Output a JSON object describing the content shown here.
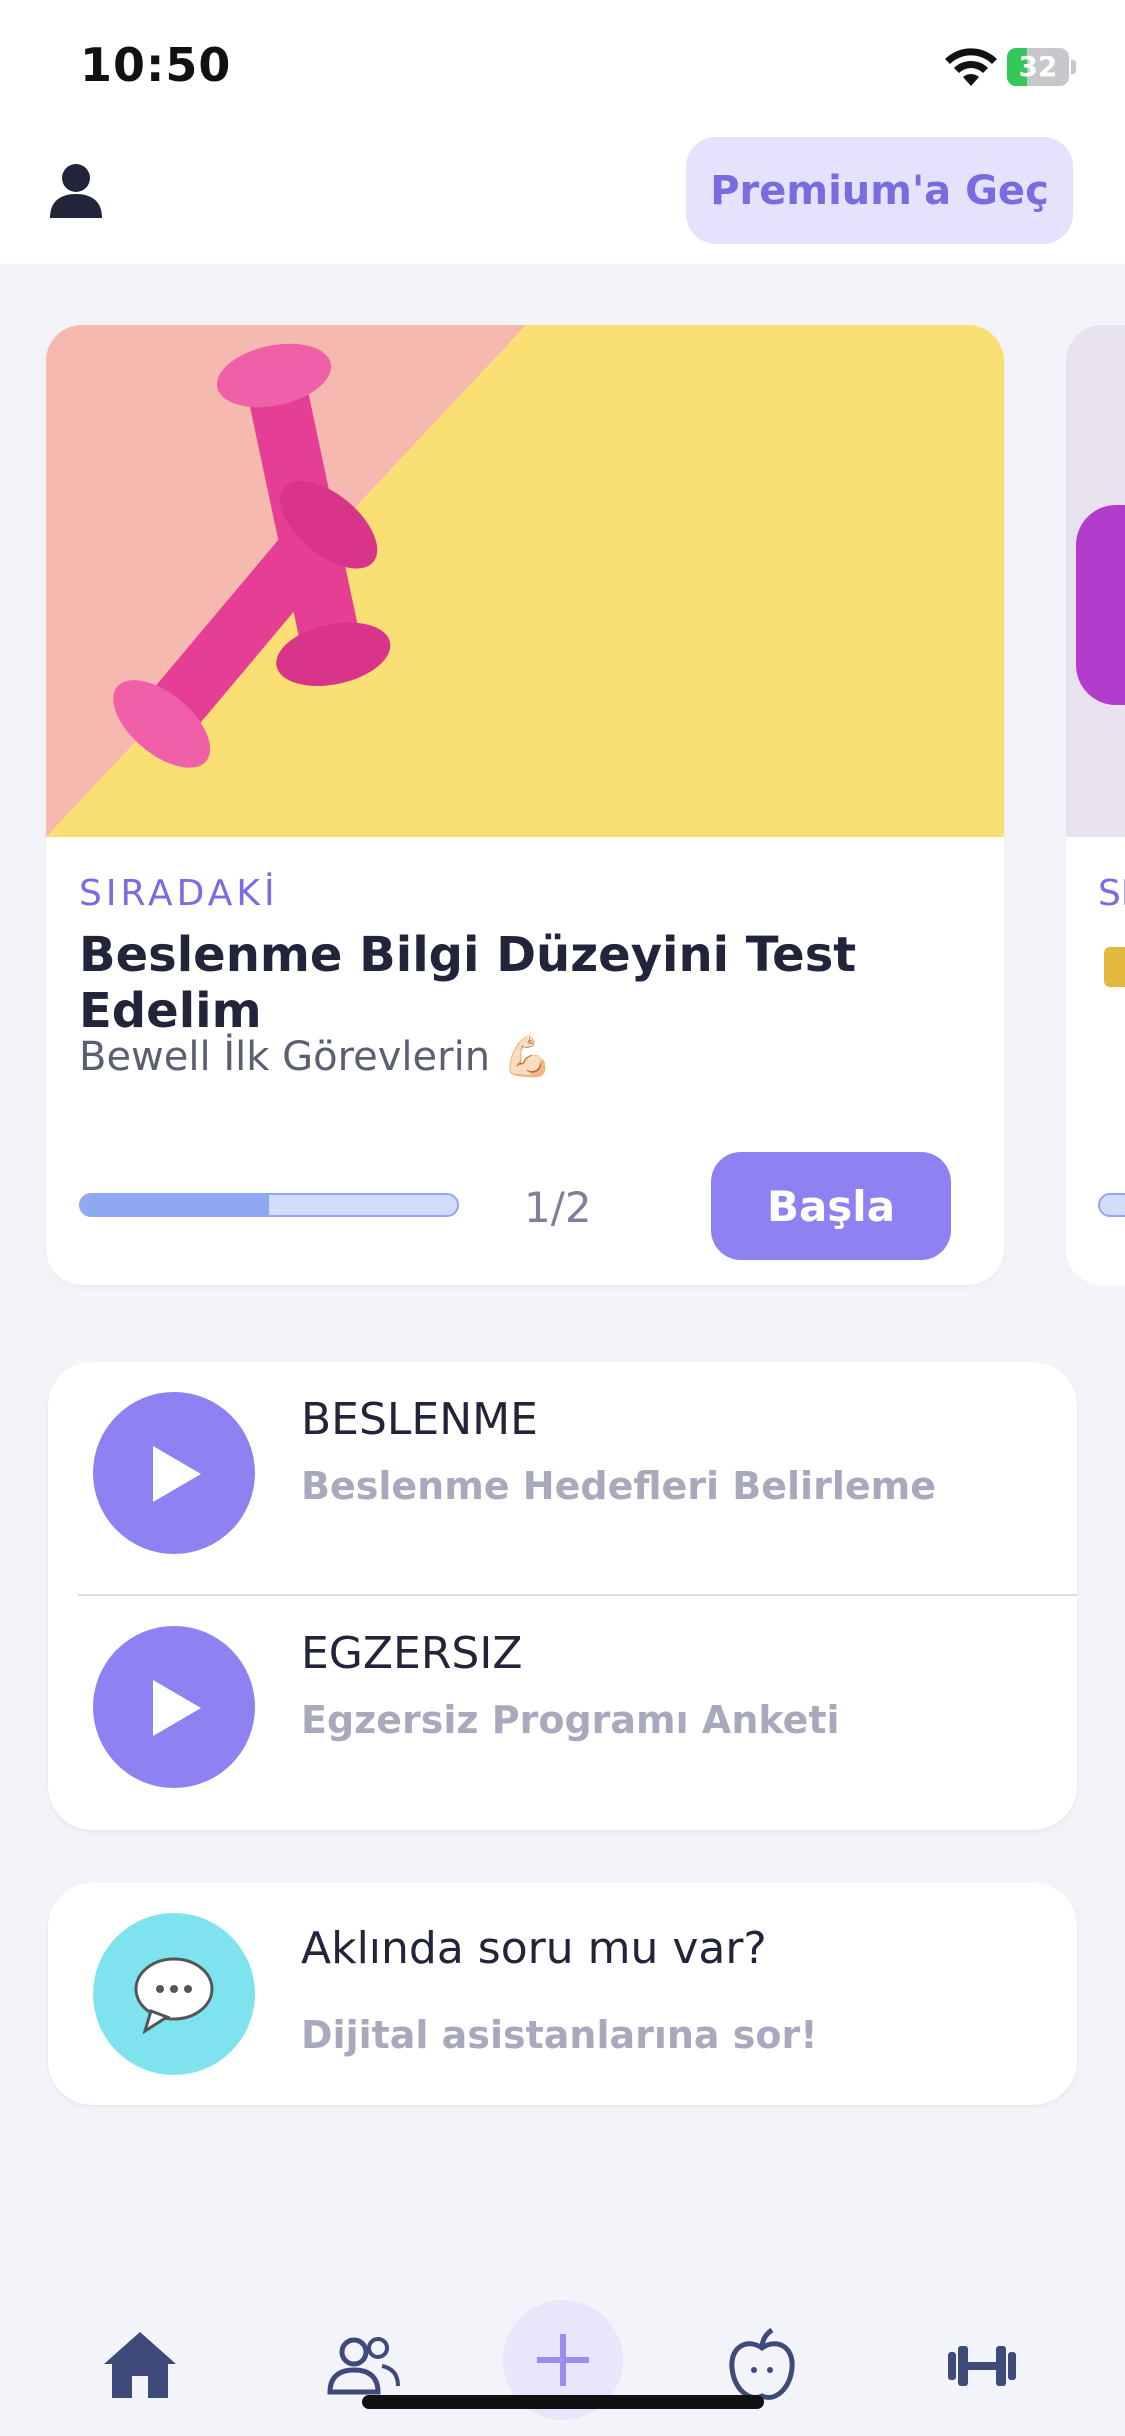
{
  "status_bar": {
    "time": "10:50",
    "battery": "32",
    "battery_level": 0.32
  },
  "header": {
    "premium_label": "Premium'a Geç"
  },
  "featured_card": {
    "eyebrow": "SIRADAKİ",
    "title": "Beslenme Bilgi Düzeyini Test Edelim",
    "subtitle": "Bewell İlk Görevlerin 💪🏻",
    "progress_text": "1/2",
    "progress_value": 0.5,
    "start_label": "Başla"
  },
  "next_card": {
    "eyebrow": "SIRADAKİ"
  },
  "tasks": [
    {
      "category": "BESLENME",
      "title": "Beslenme Hedefleri Belirleme"
    },
    {
      "category": "EGZERSIZ",
      "title": "Egzersiz Programı Anketi"
    }
  ],
  "assistant": {
    "title": "Aklında soru mu var?",
    "subtitle": "Dijital asistanlarına sor!"
  },
  "tab_bar": {
    "items": [
      "home-icon",
      "community-icon",
      "add-icon",
      "nutrition-icon",
      "exercise-icon"
    ],
    "accent": "#8E82F2"
  },
  "colors": {
    "accent": "#8E82F2",
    "background": "#F3F4F9",
    "premium_bg": "#E5E2FC",
    "assistant": "#7EE3EF"
  }
}
